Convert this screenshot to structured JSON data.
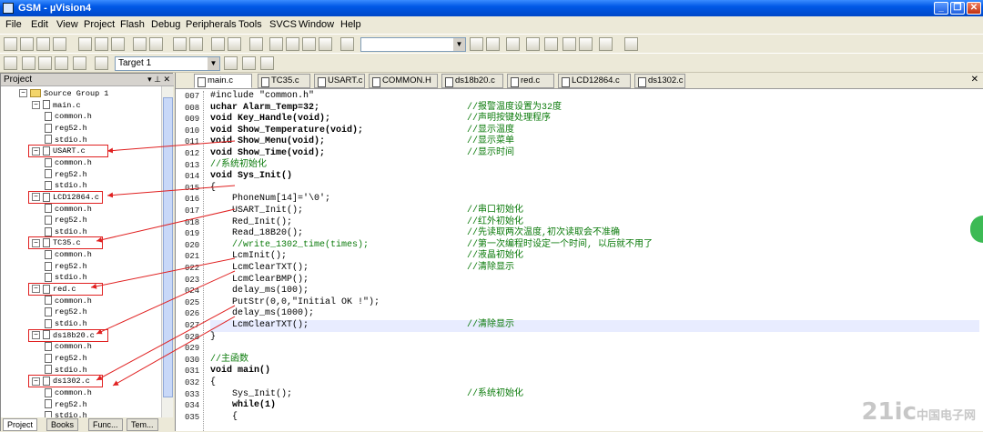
{
  "window": {
    "title": "GSM  - µVision4"
  },
  "menu": [
    "File",
    "Edit",
    "View",
    "Project",
    "Flash",
    "Debug",
    "Peripherals",
    "Tools",
    "SVCS",
    "Window",
    "Help"
  ],
  "toolbar2": {
    "target": "Target 1"
  },
  "project_pane": {
    "title": "Project",
    "root": "Source Group 1",
    "files": [
      {
        "name": "main.c",
        "children": [
          "common.h",
          "reg52.h",
          "stdio.h"
        ]
      },
      {
        "name": "USART.c",
        "children": [
          "common.h",
          "reg52.h",
          "stdio.h"
        ]
      },
      {
        "name": "LCD12864.c",
        "children": [
          "common.h",
          "reg52.h",
          "stdio.h"
        ]
      },
      {
        "name": "TC35.c",
        "children": [
          "common.h",
          "reg52.h",
          "stdio.h"
        ]
      },
      {
        "name": "red.c",
        "children": [
          "common.h",
          "reg52.h",
          "stdio.h"
        ]
      },
      {
        "name": "ds18b20.c",
        "children": [
          "common.h",
          "reg52.h",
          "stdio.h"
        ]
      },
      {
        "name": "ds1302.c",
        "children": [
          "common.h",
          "reg52.h",
          "stdio.h"
        ]
      }
    ],
    "bottom_tabs": [
      "Project",
      "Books",
      "Func...",
      "Tem..."
    ]
  },
  "editor_tabs": [
    "main.c",
    "TC35.c",
    "USART.c",
    "COMMON.H",
    "ds18b20.c",
    "red.c",
    "LCD12864.c",
    "ds1302.c"
  ],
  "code_lines": [
    {
      "n": "007",
      "code": "#include \"common.h\"",
      "cmt": ""
    },
    {
      "n": "008",
      "code": "uchar Alarm_Temp=32;",
      "cmt": "//报警温度设置为32度"
    },
    {
      "n": "009",
      "code": "void Key_Handle(void);",
      "cmt": "//声明按键处理程序"
    },
    {
      "n": "010",
      "code": "void Show_Temperature(void);",
      "cmt": "//显示温度"
    },
    {
      "n": "011",
      "code": "void Show_Menu(void);",
      "cmt": "//显示菜单"
    },
    {
      "n": "012",
      "code": "void Show_Time(void);",
      "cmt": "//显示时间"
    },
    {
      "n": "013",
      "code": "//系统初始化",
      "cmt": ""
    },
    {
      "n": "014",
      "code": "void Sys_Init()",
      "cmt": ""
    },
    {
      "n": "015",
      "code": "{",
      "cmt": ""
    },
    {
      "n": "016",
      "code": "    PhoneNum[14]='\\0';",
      "cmt": ""
    },
    {
      "n": "017",
      "code": "    USART_Init();",
      "cmt": "//串口初始化"
    },
    {
      "n": "018",
      "code": "    Red_Init();",
      "cmt": "//红外初始化"
    },
    {
      "n": "019",
      "code": "    Read_18B20();",
      "cmt": "//先读取两次温度,初次读取会不准确"
    },
    {
      "n": "020",
      "code": "    //write_1302_time(times);",
      "cmt": "//第一次编程时设定一个时间, 以后就不用了"
    },
    {
      "n": "021",
      "code": "    LcmInit();",
      "cmt": "//液晶初始化"
    },
    {
      "n": "022",
      "code": "    LcmClearTXT();",
      "cmt": "//清除显示"
    },
    {
      "n": "023",
      "code": "    LcmClearBMP();",
      "cmt": ""
    },
    {
      "n": "024",
      "code": "    delay_ms(100);",
      "cmt": ""
    },
    {
      "n": "025",
      "code": "    PutStr(0,0,\"Initial OK !\");",
      "cmt": ""
    },
    {
      "n": "026",
      "code": "    delay_ms(1000);",
      "cmt": ""
    },
    {
      "n": "027",
      "code": "    LcmClearTXT();",
      "cmt": "//清除显示"
    },
    {
      "n": "028",
      "code": "}",
      "cmt": ""
    },
    {
      "n": "029",
      "code": "",
      "cmt": ""
    },
    {
      "n": "030",
      "code": "//主函数",
      "cmt": ""
    },
    {
      "n": "031",
      "code": "void main()",
      "cmt": ""
    },
    {
      "n": "032",
      "code": "{",
      "cmt": ""
    },
    {
      "n": "033",
      "code": "    Sys_Init();",
      "cmt": "//系统初始化"
    },
    {
      "n": "034",
      "code": "    while(1)",
      "cmt": ""
    },
    {
      "n": "035",
      "code": "    {",
      "cmt": ""
    }
  ],
  "watermark": {
    "text": "21ic",
    "sub": "中国电子网"
  },
  "colors": {
    "title_bar": "#0058e6",
    "comment": "#0a7a0a",
    "annotation": "#e02020",
    "current_line": "#e8ecff"
  }
}
